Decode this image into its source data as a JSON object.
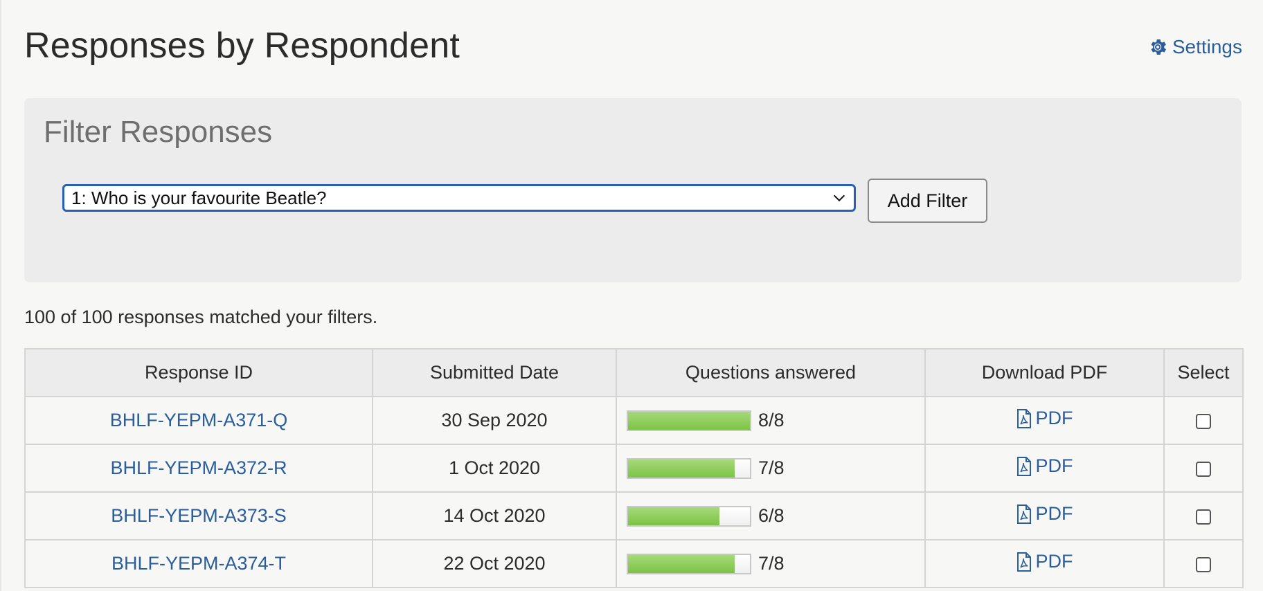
{
  "header": {
    "title": "Responses by Respondent",
    "settings_label": "Settings"
  },
  "filter": {
    "title": "Filter Responses",
    "selected_question": "1: Who is your favourite Beatle?",
    "add_button_label": "Add Filter"
  },
  "summary": {
    "match_text": "100 of 100 responses matched your filters."
  },
  "table": {
    "columns": [
      "Response ID",
      "Submitted Date",
      "Questions answered",
      "Download PDF",
      "Select"
    ],
    "rows": [
      {
        "id": "BHLF-YEPM-A371-Q",
        "date": "30 Sep 2020",
        "answered": 8,
        "total": 8,
        "answered_text": "8/8",
        "pdf_label": "PDF",
        "selected": false
      },
      {
        "id": "BHLF-YEPM-A372-R",
        "date": "1 Oct 2020",
        "answered": 7,
        "total": 8,
        "answered_text": "7/8",
        "pdf_label": "PDF",
        "selected": false
      },
      {
        "id": "BHLF-YEPM-A373-S",
        "date": "14 Oct 2020",
        "answered": 6,
        "total": 8,
        "answered_text": "6/8",
        "pdf_label": "PDF",
        "selected": false
      },
      {
        "id": "BHLF-YEPM-A374-T",
        "date": "22 Oct 2020",
        "answered": 7,
        "total": 8,
        "answered_text": "7/8",
        "pdf_label": "PDF",
        "selected": false
      }
    ]
  },
  "colors": {
    "link": "#2a5d9c",
    "focus_border": "#2a5fb8",
    "progress_fill": "#7cc345",
    "panel_bg": "#ececec",
    "page_bg": "#f7f7f6"
  },
  "icons": {
    "settings": "gear-icon",
    "pdf": "pdf-file-icon",
    "select_arrow": "chevron-down-icon"
  }
}
